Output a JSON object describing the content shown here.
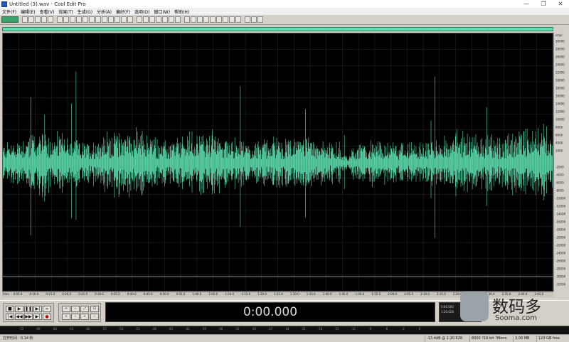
{
  "window": {
    "title": "Untitled (3).wav - Cool Edit Pro",
    "minimize_glyph": "—",
    "maximize_glyph": "❐",
    "close_glyph": "✕"
  },
  "menu": [
    "文件(F)",
    "编辑(E)",
    "查看(V)",
    "效果(T)",
    "生成(G)",
    "分析(A)",
    "偏好(F)",
    "选项(O)",
    "窗口(W)",
    "帮助(H)"
  ],
  "waveform": {
    "color": "#5ee0b0",
    "background": "#000000",
    "grid_color": "#2a2a2a",
    "channel": "Mono"
  },
  "y_axis": {
    "unit": "smpl",
    "ticks": [
      "30000",
      "28000",
      "26000",
      "24000",
      "22000",
      "20000",
      "18000",
      "16000",
      "14000",
      "12000",
      "10000",
      "8000",
      "6000",
      "4000",
      "2000",
      "",
      "-2000",
      "-4000",
      "-6000",
      "-8000",
      "-10000",
      "-12000",
      "-14000",
      "-16000",
      "-18000",
      "-20000",
      "-22000",
      "-24000",
      "-26000",
      "-28000",
      "-30000",
      "-32000"
    ]
  },
  "time_axis": {
    "unit": "hms",
    "ticks": [
      "0:05.0",
      "0:10.0",
      "0:15.0",
      "0:20.0",
      "0:25.0",
      "0:30.0",
      "0:35.0",
      "0:40.0",
      "0:45.0",
      "0:50.0",
      "0:55.0",
      "1:00.0",
      "1:05.0",
      "1:10.0",
      "1:15.0",
      "1:20.0",
      "1:25.0",
      "1:30.0",
      "1:35.0",
      "1:40.0",
      "1:45.0",
      "1:50.0",
      "1:55.0",
      "2:00.0",
      "2:05.0",
      "2:10.0",
      "2:15.0",
      "2:20.0",
      "2:25.0",
      "2:30.0",
      "2:35.0",
      "2:40.0",
      "2:45.0"
    ]
  },
  "transport": {
    "stop": "■",
    "play": "▶",
    "pause": "❚❚",
    "play_to_end": "▶|",
    "loop": "∞",
    "go_start": "|◀",
    "rewind": "◀◀",
    "fast_forward": "▶▶",
    "go_end": "▶|",
    "record": "●"
  },
  "zoom": {
    "zoom_in_h": "+",
    "zoom_out_h": "−",
    "zoom_full": "⤢",
    "zoom_in_v": "+",
    "zoom_out_v": "−",
    "zoom_sel": "⊡"
  },
  "time_display": "0:00.000",
  "selection_panel": {
    "begin": "0:00.000",
    "end": "1:20.628"
  },
  "level_meter": {
    "ticks": [
      "-72",
      "-69",
      "-66",
      "-63",
      "-60",
      "-57",
      "-54",
      "-51",
      "-48",
      "-45",
      "-42",
      "-39",
      "-36",
      "-33",
      "-30",
      "-27",
      "-24",
      "-21",
      "-18",
      "-15",
      "-12",
      "-9",
      "-6",
      "-3",
      "0"
    ]
  },
  "status": {
    "open_time": "打开时间 : 0.14 秒",
    "level": "-13.4dB @ 1:20.628",
    "format": "8000 ?16-bit ?Mono",
    "size": "3.06 MB",
    "free": "123 GB free"
  },
  "watermark": {
    "cn": "数码多",
    "en": "Sooma.com"
  }
}
